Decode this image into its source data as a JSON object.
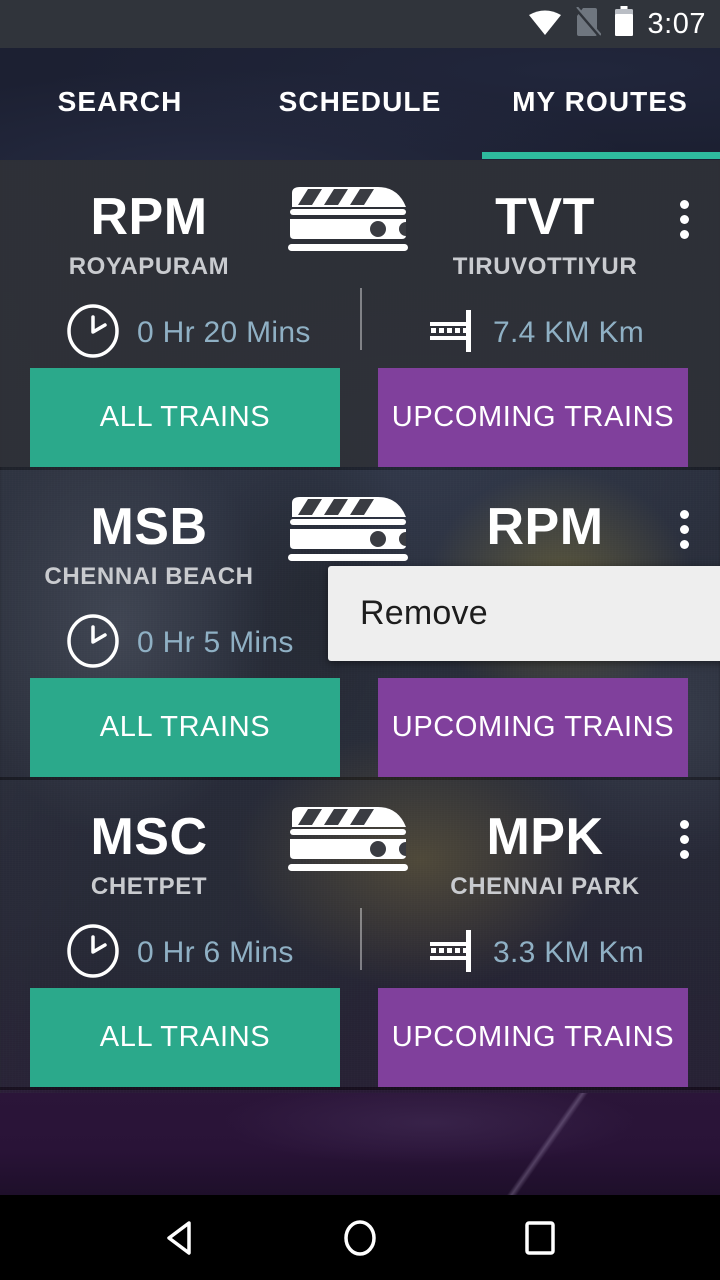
{
  "status_bar": {
    "time": "3:07",
    "icons": [
      "wifi-icon",
      "no-sim-icon",
      "battery-icon"
    ]
  },
  "tabs": [
    {
      "label": "SEARCH",
      "selected": false
    },
    {
      "label": "SCHEDULE",
      "selected": false
    },
    {
      "label": "MY ROUTES",
      "selected": true
    }
  ],
  "colors": {
    "accent_teal": "#2ebb9e",
    "button_green": "#2ba98b",
    "button_purple": "#80409c",
    "tabbar_bg": "#1c2032",
    "card_bg": "#2e3036",
    "meta_text": "#8fb0c4",
    "station_name": "#c9cbcf",
    "popup_bg": "#eeeeee"
  },
  "labels": {
    "all_trains": "ALL TRAINS",
    "upcoming_trains": "UPCOMING TRAINS"
  },
  "routes": [
    {
      "from_code": "RPM",
      "from_name": "ROYAPURAM",
      "to_code": "TVT",
      "to_name": "TIRUVOTTIYUR",
      "duration": "0 Hr 20 Mins",
      "distance": "7.4 KM Km",
      "all_trains": "ALL TRAINS",
      "upcoming_trains": "UPCOMING TRAINS"
    },
    {
      "from_code": "MSB",
      "from_name": "CHENNAI BEACH",
      "to_code": "RPM",
      "to_name": "",
      "duration": "0 Hr 5 Mins",
      "distance": "",
      "all_trains": "ALL TRAINS",
      "upcoming_trains": "UPCOMING TRAINS"
    },
    {
      "from_code": "MSC",
      "from_name": "CHETPET",
      "to_code": "MPK",
      "to_name": "CHENNAI PARK",
      "duration": "0 Hr 6 Mins",
      "distance": "3.3 KM Km",
      "all_trains": "ALL TRAINS",
      "upcoming_trains": "UPCOMING TRAINS"
    }
  ],
  "popup_menu": {
    "visible": true,
    "items": [
      {
        "label": "Remove"
      }
    ]
  },
  "nav_bar": {
    "back": "back-triangle-icon",
    "home": "home-circle-icon",
    "recents": "recents-square-icon"
  }
}
